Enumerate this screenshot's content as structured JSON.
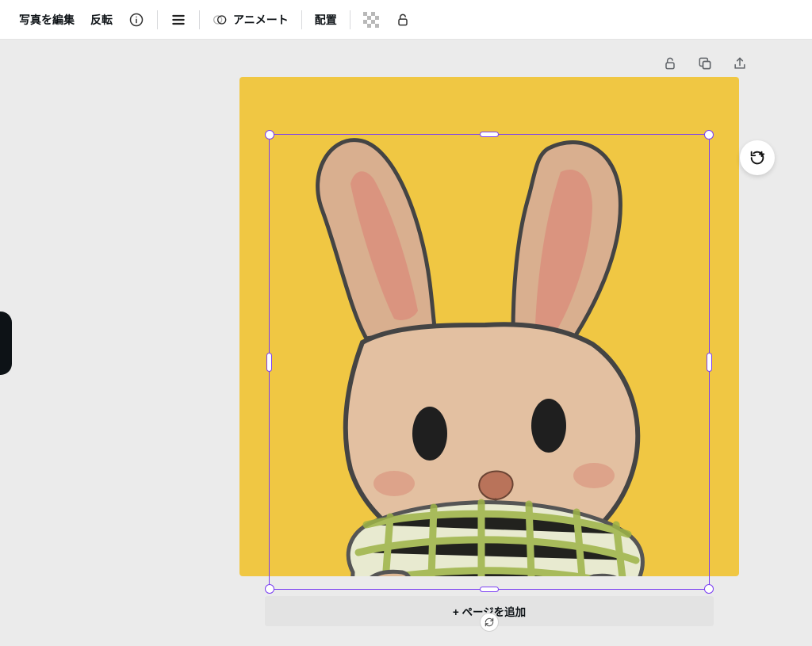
{
  "toolbar": {
    "edit_photo": "写真を編集",
    "flip": "反転",
    "animate": "アニメート",
    "position": "配置"
  },
  "actions": {
    "add_page": "+ ページを追加"
  },
  "canvas": {
    "bg": "#f0c743",
    "selection_color": "#7a3ef2"
  }
}
